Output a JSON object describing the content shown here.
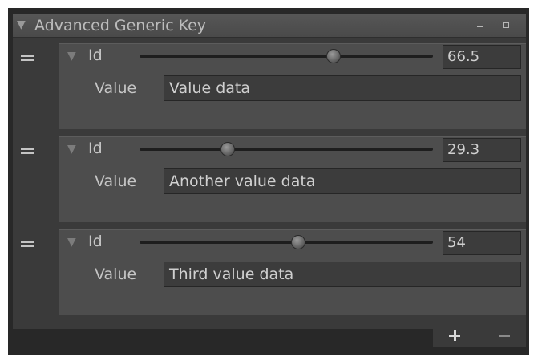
{
  "panel": {
    "title": "Advanced Generic Key",
    "collapse_icon": "triangle-down-icon",
    "minimize_icon": "minimize-icon",
    "maximize_icon": "maximize-icon"
  },
  "entries": [
    {
      "id_label": "Id",
      "id_value": "66.5",
      "slider_fraction": 0.66,
      "value_label": "Value",
      "value_text": "Value data"
    },
    {
      "id_label": "Id",
      "id_value": "29.3",
      "slider_fraction": 0.3,
      "value_label": "Value",
      "value_text": "Another value data"
    },
    {
      "id_label": "Id",
      "id_value": "54",
      "slider_fraction": 0.54,
      "value_label": "Value",
      "value_text": "Third value data"
    }
  ],
  "footer": {
    "add_icon": "plus-icon",
    "remove_icon": "minus-icon"
  }
}
